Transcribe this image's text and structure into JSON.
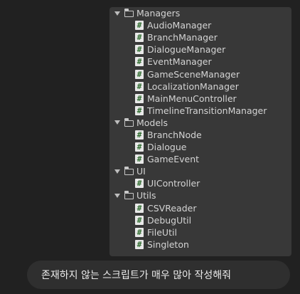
{
  "tree": {
    "rows": [
      {
        "kind": "folder",
        "label": "Managers"
      },
      {
        "kind": "file",
        "label": "AudioManager"
      },
      {
        "kind": "file",
        "label": "BranchManager"
      },
      {
        "kind": "file",
        "label": "DialogueManager"
      },
      {
        "kind": "file",
        "label": "EventManager"
      },
      {
        "kind": "file",
        "label": "GameSceneManager"
      },
      {
        "kind": "file",
        "label": "LocalizationManager"
      },
      {
        "kind": "file",
        "label": "MainMenuController"
      },
      {
        "kind": "file",
        "label": "TimelineTransitionManager"
      },
      {
        "kind": "folder",
        "label": "Models"
      },
      {
        "kind": "file",
        "label": "BranchNode"
      },
      {
        "kind": "file",
        "label": "Dialogue"
      },
      {
        "kind": "file",
        "label": "GameEvent"
      },
      {
        "kind": "folder",
        "label": "UI"
      },
      {
        "kind": "file",
        "label": "UIController"
      },
      {
        "kind": "folder",
        "label": "Utils"
      },
      {
        "kind": "file",
        "label": "CSVReader"
      },
      {
        "kind": "file",
        "label": "DebugUtil"
      },
      {
        "kind": "file",
        "label": "FileUtil"
      },
      {
        "kind": "file",
        "label": "Singleton"
      }
    ],
    "script_icon_glyph": "#"
  },
  "chat": {
    "message": "존재하지 않는 스크립트가 매우 많아 작성해줘"
  },
  "colors": {
    "page_background": "#212121",
    "panel_background": "#383838",
    "bubble_background": "#2f2f2f"
  }
}
